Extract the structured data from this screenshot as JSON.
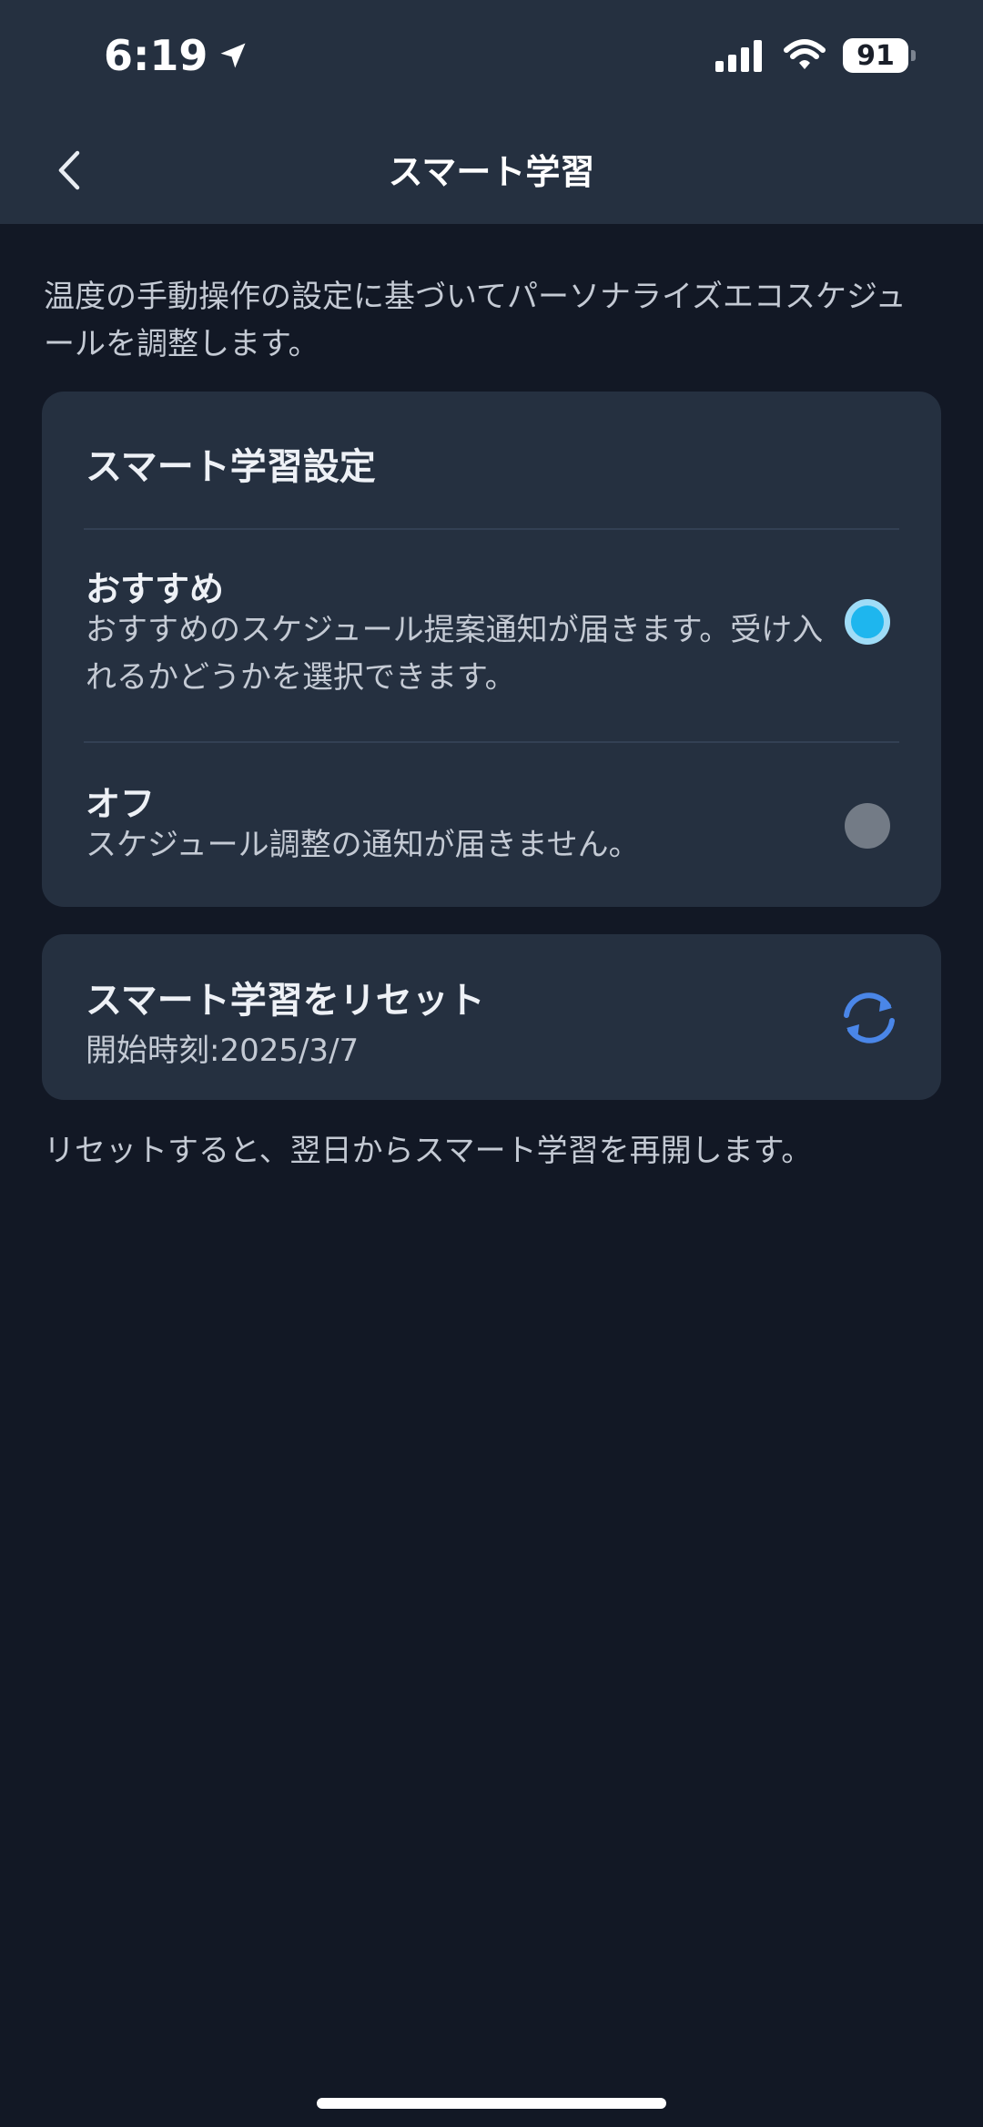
{
  "status_bar": {
    "time": "6:19",
    "battery": "91"
  },
  "nav": {
    "title": "スマート学習"
  },
  "description": "温度の手動操作の設定に基づいてパーソナライズエコスケジュールを調整します。",
  "settings_card": {
    "title": "スマート学習設定",
    "options": [
      {
        "title": "おすすめ",
        "description": "おすすめのスケジュール提案通知が届きます。受け入れるかどうかを選択できます。",
        "selected": true
      },
      {
        "title": "オフ",
        "description": "スケジュール調整の通知が届きません。",
        "selected": false
      }
    ]
  },
  "reset_card": {
    "title": "スマート学習をリセット",
    "start_time": "開始時刻:2025/3/7",
    "icon": "refresh-icon"
  },
  "footnote": "リセットすると、翌日からスマート学習を再開します。",
  "colors": {
    "background": "#121825",
    "card": "#253040",
    "accent": "#1eb6ee",
    "refresh_icon": "#4a86e8"
  }
}
